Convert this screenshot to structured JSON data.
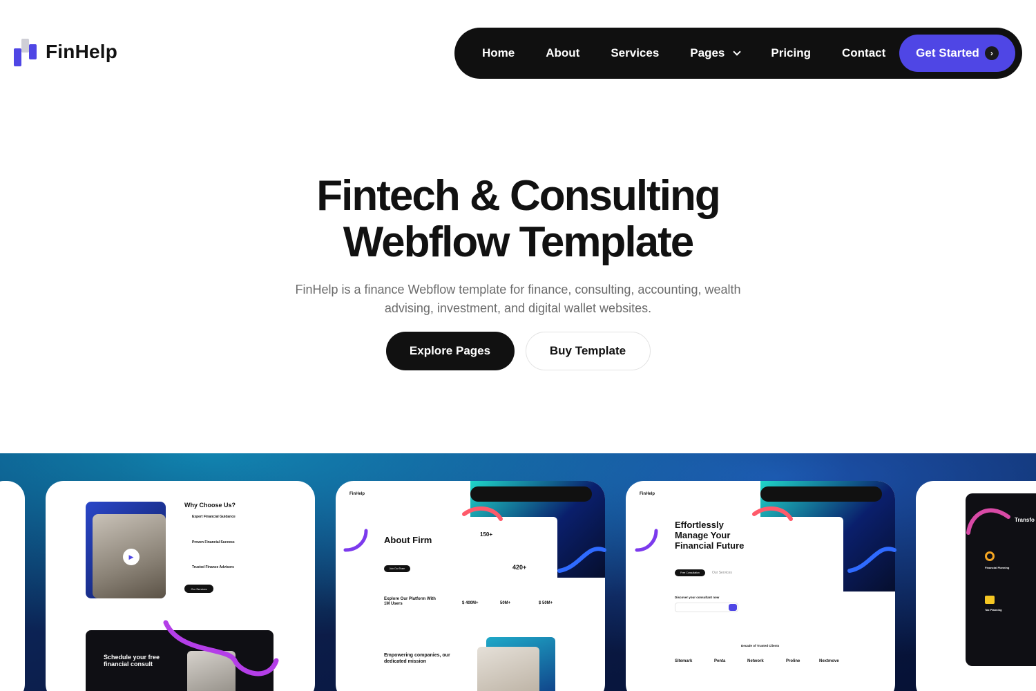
{
  "brand": {
    "name": "FinHelp"
  },
  "nav": {
    "items": [
      "Home",
      "About",
      "Services",
      "Pages",
      "Pricing",
      "Contact"
    ],
    "cta": "Get Started"
  },
  "hero": {
    "title_line1": "Fintech & Consulting",
    "title_line2": "Webflow Template",
    "subtitle": "FinHelp is a finance Webflow template for finance, consulting, accounting, wealth advising, investment, and digital wallet websites.",
    "primary_button": "Explore Pages",
    "secondary_button": "Buy Template"
  },
  "showcase": {
    "card1": {
      "heading": "Why Choose Us?",
      "items": [
        "Expert Financial Guidance",
        "Proven Financial Success",
        "Trusted Finance Advisors"
      ],
      "button": "Our Services",
      "schedule": "Schedule your free financial consult"
    },
    "card2": {
      "brand": "FinHelp",
      "heading": "About Firm",
      "button": "Join Our Team",
      "stat1": "150+",
      "stat2": "420+",
      "platform": "Explore Our Platform With 1M Users",
      "figures": [
        "$ 400M+",
        "50M+",
        "$ 50M+"
      ],
      "mission": "Empowering companies, our dedicated mission"
    },
    "card3": {
      "brand": "FinHelp",
      "heading": "Effortlessly Manage Your Financial Future",
      "button": "Free Consultation",
      "link": "Our Services",
      "consult": "Discover your consultant now",
      "clients": "Decade of Trusted Clients",
      "logos": [
        "Sitemark",
        "Penta",
        "Network",
        "Proline",
        "Nextmove"
      ]
    },
    "card4": {
      "heading": "Transfo with E",
      "items": [
        "Financial Planning",
        "Tax Planning"
      ]
    }
  },
  "colors": {
    "accent": "#4f46e5",
    "dark": "#101010"
  }
}
